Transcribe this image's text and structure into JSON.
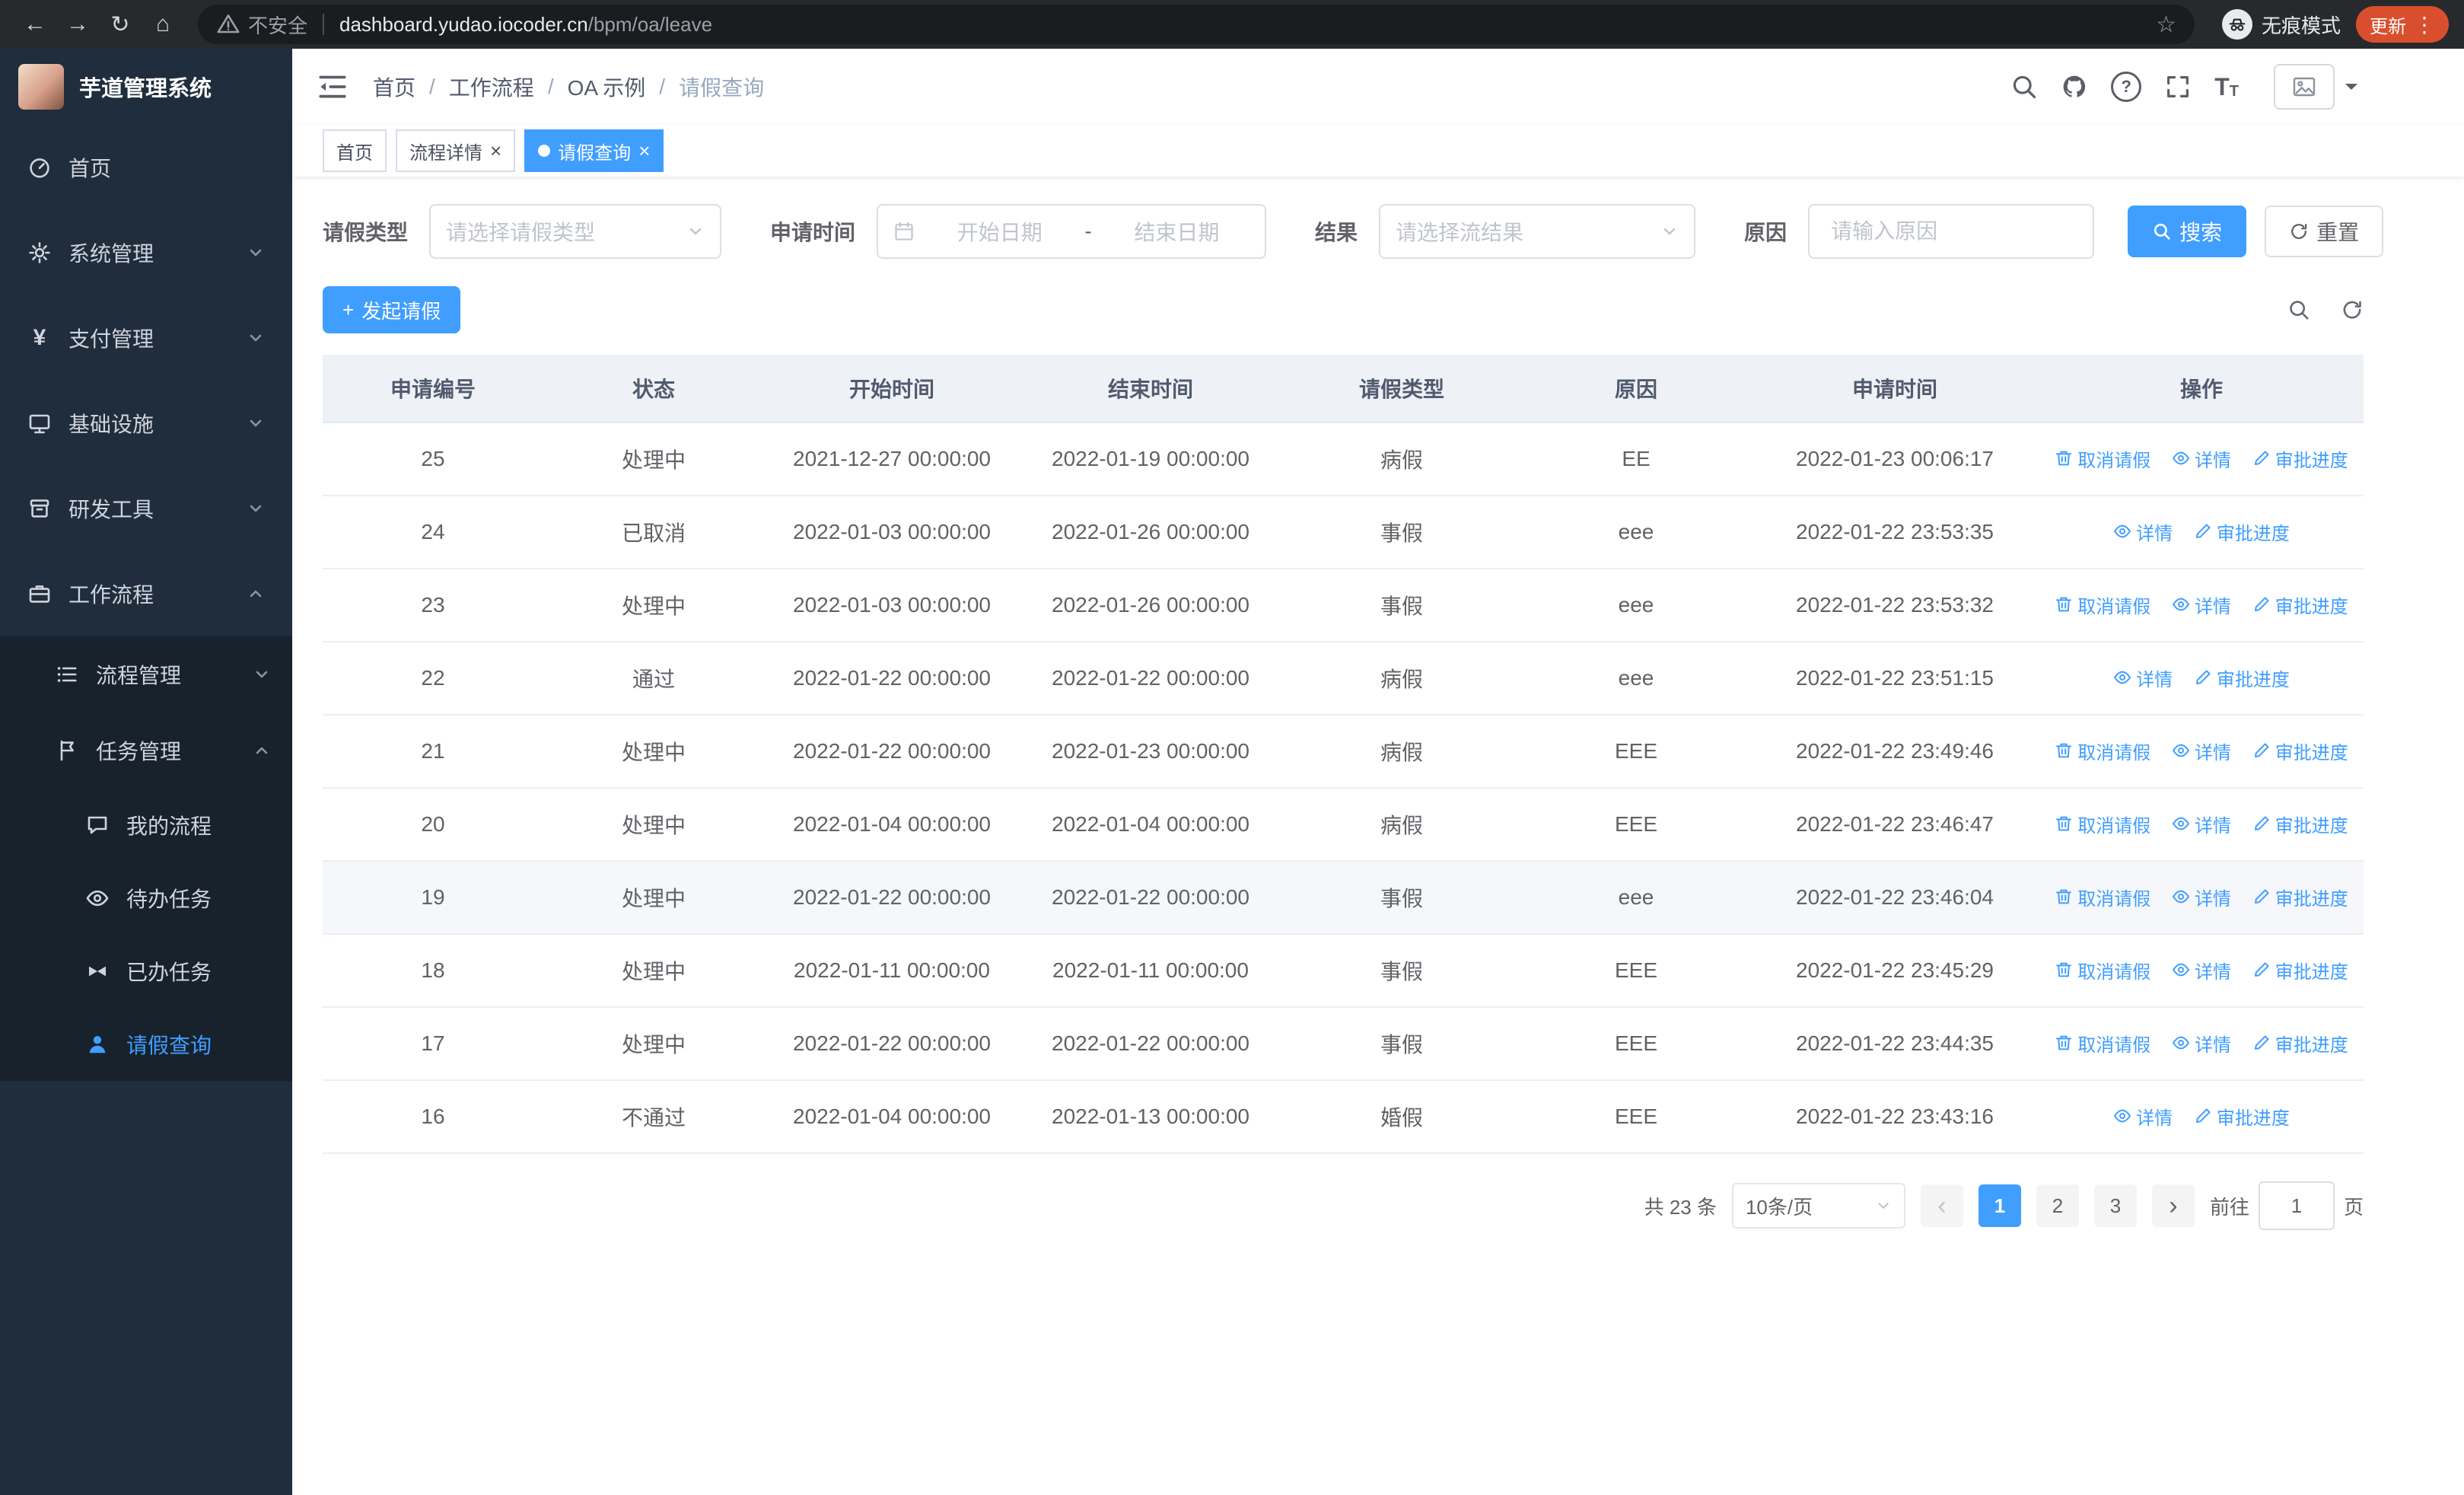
{
  "colors": {
    "primary": "#409eff",
    "sidebar_bg": "#1f2d3d",
    "submenu_bg": "#17222d",
    "update_badge": "#d94f2e",
    "table_header_bg": "#eef1f6"
  },
  "icons": {
    "back": "←",
    "forward": "→",
    "reload": "↻",
    "home": "⌂",
    "star": "☆",
    "menu_dots": "⋮",
    "close": "×",
    "plus": "+",
    "prev": "‹",
    "next": "›",
    "question": "?",
    "font_size": "T",
    "yen": "¥"
  },
  "browser": {
    "security_label": "不安全",
    "url_domain": "dashboard.yudao.iocoder.cn",
    "url_path": "/bpm/oa/leave",
    "incognito_label": "无痕模式",
    "update_label": "更新"
  },
  "sidebar": {
    "logo_title": "芋道管理系统",
    "items": [
      {
        "label": "首页"
      },
      {
        "label": "系统管理"
      },
      {
        "label": "支付管理"
      },
      {
        "label": "基础设施"
      },
      {
        "label": "研发工具"
      },
      {
        "label": "工作流程"
      }
    ],
    "submenu": {
      "process": "流程管理",
      "task": "任务管理",
      "children": [
        "我的流程",
        "待办任务",
        "已办任务",
        "请假查询"
      ]
    }
  },
  "breadcrumb": {
    "items": [
      "首页",
      "工作流程",
      "OA 示例",
      "请假查询"
    ],
    "separator": "/"
  },
  "tabs": [
    {
      "label": "首页"
    },
    {
      "label": "流程详情"
    },
    {
      "label": "请假查询"
    }
  ],
  "filters": {
    "leave_type_label": "请假类型",
    "leave_type_placeholder": "请选择请假类型",
    "apply_time_label": "申请时间",
    "start_date_placeholder": "开始日期",
    "range_separator": "-",
    "end_date_placeholder": "结束日期",
    "result_label": "结果",
    "result_placeholder": "请选择流结果",
    "reason_label": "原因",
    "reason_placeholder": "请输入原因",
    "search_button": "搜索",
    "reset_button": "重置"
  },
  "toolbar": {
    "create_button": "发起请假"
  },
  "table": {
    "headers": [
      "申请编号",
      "状态",
      "开始时间",
      "结束时间",
      "请假类型",
      "原因",
      "申请时间",
      "操作"
    ],
    "action_labels": {
      "cancel": "取消请假",
      "detail": "详情",
      "progress": "审批进度"
    },
    "rows": [
      {
        "id": "25",
        "status": "处理中",
        "start": "2021-12-27 00:00:00",
        "end": "2022-01-19 00:00:00",
        "type": "病假",
        "reason": "EE",
        "applied": "2022-01-23 00:06:17",
        "actions": [
          "cancel",
          "detail",
          "progress"
        ]
      },
      {
        "id": "24",
        "status": "已取消",
        "start": "2022-01-03 00:00:00",
        "end": "2022-01-26 00:00:00",
        "type": "事假",
        "reason": "eee",
        "applied": "2022-01-22 23:53:35",
        "actions": [
          "detail",
          "progress"
        ]
      },
      {
        "id": "23",
        "status": "处理中",
        "start": "2022-01-03 00:00:00",
        "end": "2022-01-26 00:00:00",
        "type": "事假",
        "reason": "eee",
        "applied": "2022-01-22 23:53:32",
        "actions": [
          "cancel",
          "detail",
          "progress"
        ]
      },
      {
        "id": "22",
        "status": "通过",
        "start": "2022-01-22 00:00:00",
        "end": "2022-01-22 00:00:00",
        "type": "病假",
        "reason": "eee",
        "applied": "2022-01-22 23:51:15",
        "actions": [
          "detail",
          "progress"
        ]
      },
      {
        "id": "21",
        "status": "处理中",
        "start": "2022-01-22 00:00:00",
        "end": "2022-01-23 00:00:00",
        "type": "病假",
        "reason": "EEE",
        "applied": "2022-01-22 23:49:46",
        "actions": [
          "cancel",
          "detail",
          "progress"
        ]
      },
      {
        "id": "20",
        "status": "处理中",
        "start": "2022-01-04 00:00:00",
        "end": "2022-01-04 00:00:00",
        "type": "病假",
        "reason": "EEE",
        "applied": "2022-01-22 23:46:47",
        "actions": [
          "cancel",
          "detail",
          "progress"
        ]
      },
      {
        "id": "19",
        "status": "处理中",
        "start": "2022-01-22 00:00:00",
        "end": "2022-01-22 00:00:00",
        "type": "事假",
        "reason": "eee",
        "applied": "2022-01-22 23:46:04",
        "actions": [
          "cancel",
          "detail",
          "progress"
        ],
        "highlighted": true
      },
      {
        "id": "18",
        "status": "处理中",
        "start": "2022-01-11 00:00:00",
        "end": "2022-01-11 00:00:00",
        "type": "事假",
        "reason": "EEE",
        "applied": "2022-01-22 23:45:29",
        "actions": [
          "cancel",
          "detail",
          "progress"
        ]
      },
      {
        "id": "17",
        "status": "处理中",
        "start": "2022-01-22 00:00:00",
        "end": "2022-01-22 00:00:00",
        "type": "事假",
        "reason": "EEE",
        "applied": "2022-01-22 23:44:35",
        "actions": [
          "cancel",
          "detail",
          "progress"
        ]
      },
      {
        "id": "16",
        "status": "不通过",
        "start": "2022-01-04 00:00:00",
        "end": "2022-01-13 00:00:00",
        "type": "婚假",
        "reason": "EEE",
        "applied": "2022-01-22 23:43:16",
        "actions": [
          "detail",
          "progress"
        ]
      }
    ]
  },
  "pagination": {
    "total_text": "共 23 条",
    "page_size": "10条/页",
    "pages": [
      "1",
      "2",
      "3"
    ],
    "active_page": "1",
    "goto_label": "前往",
    "goto_value": "1",
    "page_unit": "页"
  }
}
